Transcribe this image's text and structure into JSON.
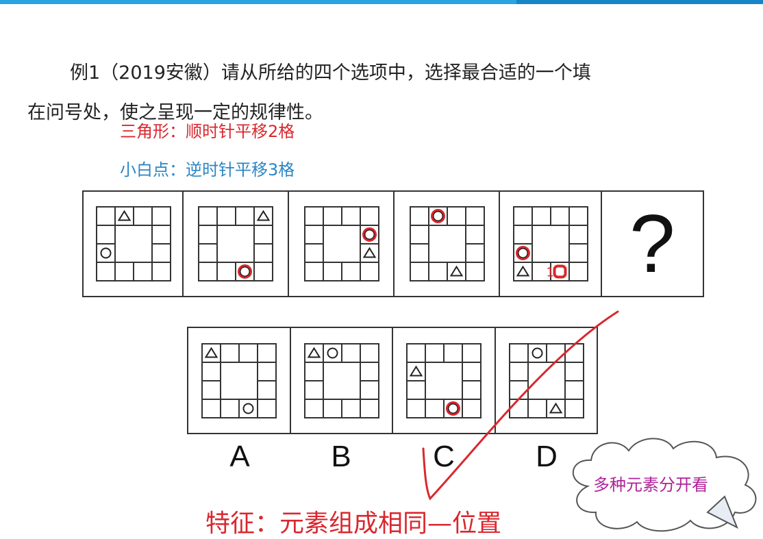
{
  "question": {
    "prefix": "例1（2019安徽）请从所给的四个选项中，选择最合适的一个填",
    "line2": "在问号处，使之呈现一定的规律性。"
  },
  "hints": {
    "triangle": "三角形：顺时针平移2格",
    "dot": "小白点：逆时针平移3格"
  },
  "question_mark": "?",
  "options": [
    "A",
    "B",
    "C",
    "D"
  ],
  "feature": "特征：元素组成相同—位置",
  "cloud": "多种元素分开看",
  "colors": {
    "accent": "#2aa3e0",
    "red": "#d9272e",
    "blue": "#2a86c4",
    "cloud_text": "#b0229a"
  },
  "annotation_mark": "1"
}
